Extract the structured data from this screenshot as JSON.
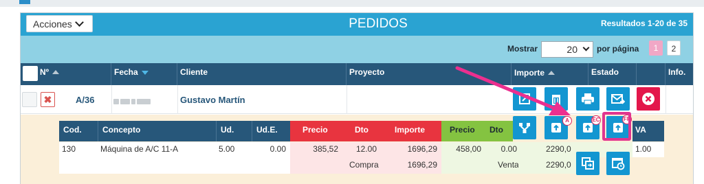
{
  "toolbar": {
    "actions_label": "Acciones",
    "title": "PEDIDOS",
    "results": "Resultados 1-20 de 35"
  },
  "pagination": {
    "show_label": "Mostrar",
    "per_page_value": "20",
    "per_page_label": "por página",
    "pages": [
      "1",
      "2"
    ],
    "current_page": "1"
  },
  "columns": {
    "num": "Nº",
    "fecha": "Fecha",
    "cliente": "Cliente",
    "proyecto": "Proyecto",
    "importe": "Importe",
    "estado": "Estado",
    "info": "Info."
  },
  "order": {
    "number": "A/36",
    "client": "Gustavo Martín"
  },
  "detail": {
    "headers": {
      "cod": "Cod.",
      "concepto": "Concepto",
      "ud": "Ud.",
      "ude": "Ud.E.",
      "precio_compra": "Precio",
      "dto_compra": "Dto",
      "importe_compra": "Importe",
      "precio_venta": "Precio",
      "dto_venta": "Dto",
      "iva": "VA"
    },
    "line": {
      "cod": "130",
      "concepto": "Máquina de A/C 11-A",
      "ud": "5.00",
      "ude": "0.00",
      "precio_compra": "385,52",
      "dto_compra": "12.00",
      "importe_compra": "1696,29",
      "precio_venta": "458,00",
      "dto_venta": "0.00",
      "importe_venta": "2290,0",
      "iva": "1.00"
    },
    "totals": {
      "compra_label": "Compra",
      "compra_value": "1696,29",
      "venta_label": "Venta",
      "venta_value": "2290,0"
    }
  },
  "action_buttons": {
    "badge_a": "A",
    "badge_ec": "EC",
    "badge_fp": "FP"
  },
  "colors": {
    "title_bar": "#2aa3d2",
    "filter_bar": "#8fd1e4",
    "header": "#27577a",
    "compra": "#e8343f",
    "venta": "#84c341",
    "action_button": "#1396d1",
    "delete_button": "#e3174b",
    "highlight": "#e0358f"
  }
}
